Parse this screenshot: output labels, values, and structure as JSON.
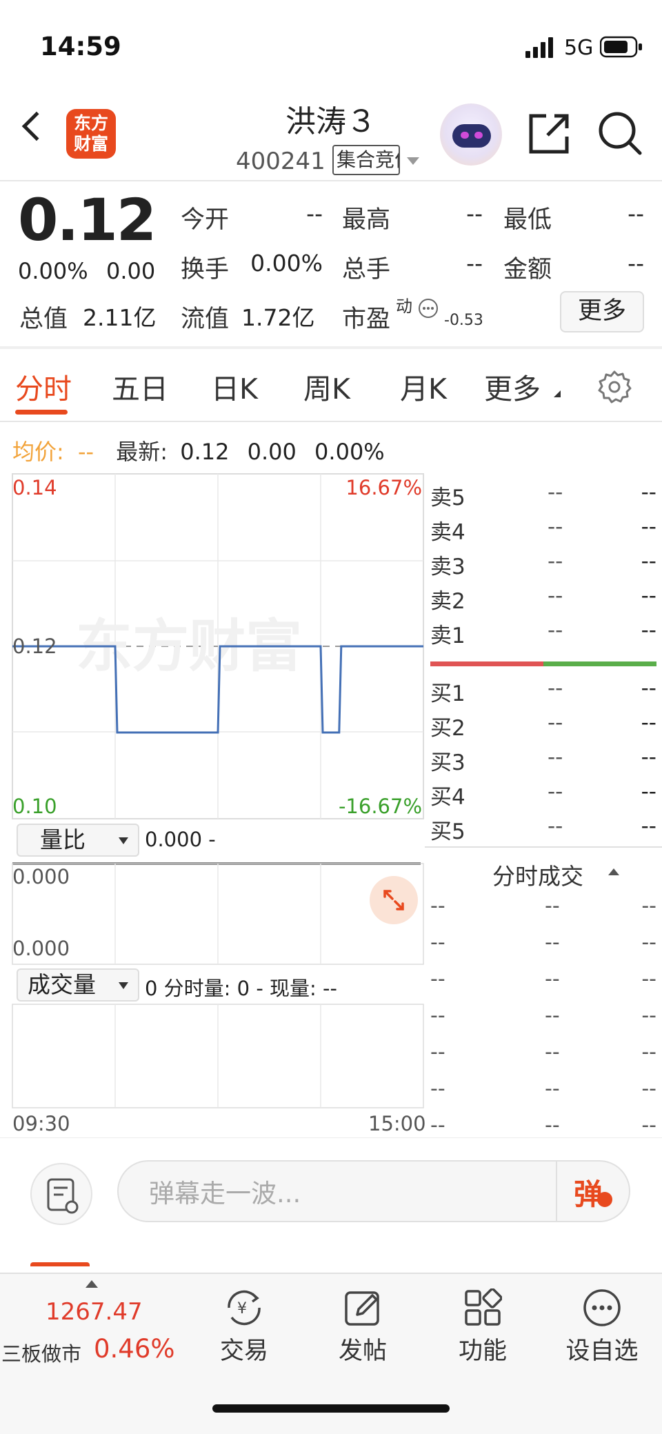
{
  "status_bar": {
    "time": "14:59",
    "network": "5G"
  },
  "header": {
    "logo_text_line1": "东方",
    "logo_text_line2": "财富",
    "stock_name": "洪涛３",
    "stock_code": "400241",
    "trade_status": "集合竞价"
  },
  "quote": {
    "price": "0.12",
    "change_pct": "0.00%",
    "change_amt": "0.00",
    "total_mv_label": "总值",
    "total_mv": "2.11亿",
    "float_mv_label": "流值",
    "float_mv": "1.72亿",
    "pe_label": "市盈",
    "pe_sup": "动",
    "pe_value": "-0.53",
    "fields": [
      {
        "label": "今开",
        "value": "--"
      },
      {
        "label": "最高",
        "value": "--"
      },
      {
        "label": "最低",
        "value": "--"
      },
      {
        "label": "换手",
        "value": "0.00%"
      },
      {
        "label": "总手",
        "value": "--"
      },
      {
        "label": "金额",
        "value": "--"
      }
    ],
    "more_label": "更多"
  },
  "tabs": [
    "分时",
    "五日",
    "日K",
    "周K",
    "月K",
    "更多"
  ],
  "info_line": {
    "avg_label": "均价:",
    "avg_value": "--",
    "latest_label": "最新:",
    "latest_price": "0.12",
    "latest_change": "0.00",
    "latest_pct": "0.00%"
  },
  "price_chart": {
    "y_top": "0.14",
    "y_mid": "0.12",
    "y_bottom": "0.10",
    "pct_top": "16.67%",
    "pct_bottom": "-16.67%",
    "watermark": "东方财富",
    "time_start": "09:30",
    "time_end": "15:00"
  },
  "chart_data": {
    "type": "line",
    "title": "",
    "x": [
      "09:30",
      "15:00"
    ],
    "series": [
      {
        "values": [
          0.12,
          0.12,
          0.11,
          0.11,
          0.12,
          0.12,
          0.11,
          0.11,
          0.12,
          0.12
        ]
      }
    ],
    "ylim": [
      0.1,
      0.14
    ],
    "reference_price": 0.12,
    "grid": true
  },
  "volume_ratio": {
    "selector": "量比",
    "value": "0.000 -",
    "y_top": "0.000",
    "y_bottom": "0.000"
  },
  "volume": {
    "selector": "成交量",
    "info": "0 分时量: 0 - 现量: --"
  },
  "order_book": {
    "asks": [
      {
        "label": "卖5",
        "price": "--",
        "vol": "--"
      },
      {
        "label": "卖4",
        "price": "--",
        "vol": "--"
      },
      {
        "label": "卖3",
        "price": "--",
        "vol": "--"
      },
      {
        "label": "卖2",
        "price": "--",
        "vol": "--"
      },
      {
        "label": "卖1",
        "price": "--",
        "vol": "--"
      }
    ],
    "bids": [
      {
        "label": "买1",
        "price": "--",
        "vol": "--"
      },
      {
        "label": "买2",
        "price": "--",
        "vol": "--"
      },
      {
        "label": "买3",
        "price": "--",
        "vol": "--"
      },
      {
        "label": "买4",
        "price": "--",
        "vol": "--"
      },
      {
        "label": "买5",
        "price": "--",
        "vol": "--"
      }
    ]
  },
  "ticks": {
    "title": "分时成交",
    "rows": [
      [
        "--",
        "--",
        "--"
      ],
      [
        "--",
        "--",
        "--"
      ],
      [
        "--",
        "--",
        "--"
      ],
      [
        "--",
        "--",
        "--"
      ],
      [
        "--",
        "--",
        "--"
      ],
      [
        "--",
        "--",
        "--"
      ],
      [
        "--",
        "--",
        "--"
      ]
    ]
  },
  "comment_bar": {
    "placeholder": "弹幕走一波...",
    "danmu_label": "弹"
  },
  "bottom_nav": {
    "index_value": "1267.47",
    "index_name": "三板做市",
    "index_pct": "0.46%",
    "items": [
      {
        "label": "交易",
        "icon": "yuan-exchange-icon"
      },
      {
        "label": "发帖",
        "icon": "edit-icon"
      },
      {
        "label": "功能",
        "icon": "grid-icon"
      },
      {
        "label": "设自选",
        "icon": "more-icon"
      }
    ]
  },
  "colors": {
    "brand": "#e8491e",
    "up": "#e03b2a",
    "down": "#3aa02b",
    "line": "#4470b6",
    "avg": "#f2a33a"
  }
}
